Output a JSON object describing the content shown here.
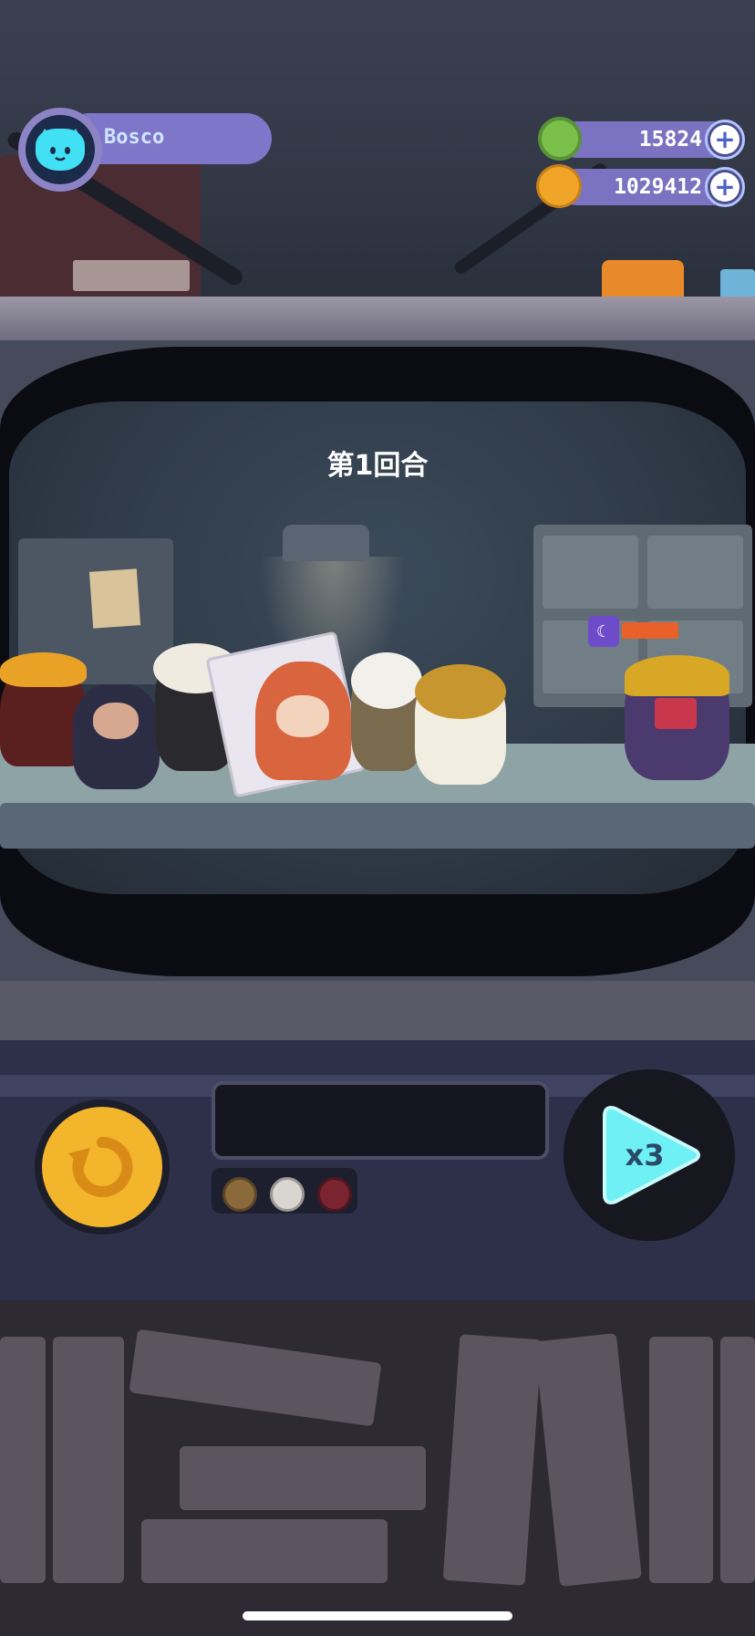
{
  "hud": {
    "player_name": "Bosco",
    "avatar_icon": "cat-face-icon",
    "currencies": [
      {
        "name": "donut",
        "icon": "donut-icon",
        "value": "15824"
      },
      {
        "name": "coin-planet",
        "icon": "planet-icon",
        "value": "1029412"
      }
    ]
  },
  "battle": {
    "round_title": "第1回合",
    "enemy_health_fraction": 1.0
  },
  "controls": {
    "retry_icon": "retry-icon",
    "speed_label": "x3",
    "indicator_dots": [
      {
        "color": "#8a6a3a"
      },
      {
        "color": "#d9d6d2"
      },
      {
        "color": "#7a2430"
      }
    ]
  },
  "colors": {
    "accent_purple": "#7e76c8",
    "speed_cyan": "#6ff0f5",
    "retry_gold": "#f2b52c",
    "enemy_health": "#e8612a"
  }
}
